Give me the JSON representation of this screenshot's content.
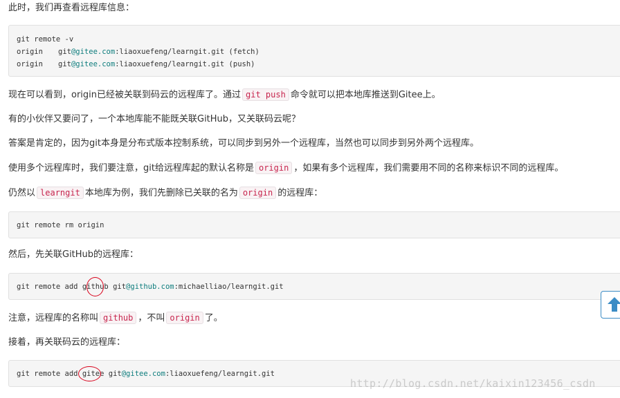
{
  "paragraphs": {
    "p1": "此时，我们再查看远程库信息：",
    "p2_a": "现在可以看到，origin已经被关联到码云的远程库了。通过",
    "p2_code": "git push",
    "p2_b": "命令就可以把本地库推送到Gitee上。",
    "p3": "有的小伙伴又要问了，一个本地库能不能既关联GitHub，又关联码云呢？",
    "p4": "答案是肯定的，因为git本身是分布式版本控制系统，可以同步到另外一个远程库，当然也可以同步到另外两个远程库。",
    "p5_a": "使用多个远程库时，我们要注意，git给远程库起的默认名称是",
    "p5_code": "origin",
    "p5_b": "，如果有多个远程库，我们需要用不同的名称来标识不同的远程库。",
    "p6_a": "仍然以",
    "p6_code1": "learngit",
    "p6_b": "本地库为例，我们先删除已关联的名为",
    "p6_code2": "origin",
    "p6_c": "的远程库：",
    "p7": "然后，先关联GitHub的远程库：",
    "p8_a": "注意，远程库的名称叫",
    "p8_code1": "github",
    "p8_b": "，不叫",
    "p8_code2": "origin",
    "p8_c": "了。",
    "p9": "接着，再关联码云的远程库："
  },
  "code_blocks": {
    "block1": {
      "line1": "git remote -v",
      "line2_name": "origin",
      "line2_user": "git",
      "line2_host": "@gitee.com",
      "line2_rest": ":liaoxuefeng/learngit.git (fetch)",
      "line3_name": "origin",
      "line3_user": "git",
      "line3_host": "@gitee.com",
      "line3_rest": ":liaoxuefeng/learngit.git (push)"
    },
    "block2": {
      "line1": "git remote rm origin"
    },
    "block3": {
      "prefix": "git remote add github ",
      "user": "git",
      "host": "@github.com",
      "rest": ":michaelliao/learngit.git"
    },
    "block4": {
      "prefix": "git remote add gitee ",
      "user": "git",
      "host": "@gitee.com",
      "rest": ":liaoxuefeng/learngit.git"
    }
  },
  "watermark": "http://blog.csdn.net/kaixin123456_csdn",
  "icons": {
    "scroll_top": "arrow-up-icon"
  },
  "colors": {
    "inline_code": "#c7254e",
    "host_teal": "#0e7d7d",
    "annotation_circle": "#d8001a",
    "scroll_button": "#3b8cc5"
  }
}
